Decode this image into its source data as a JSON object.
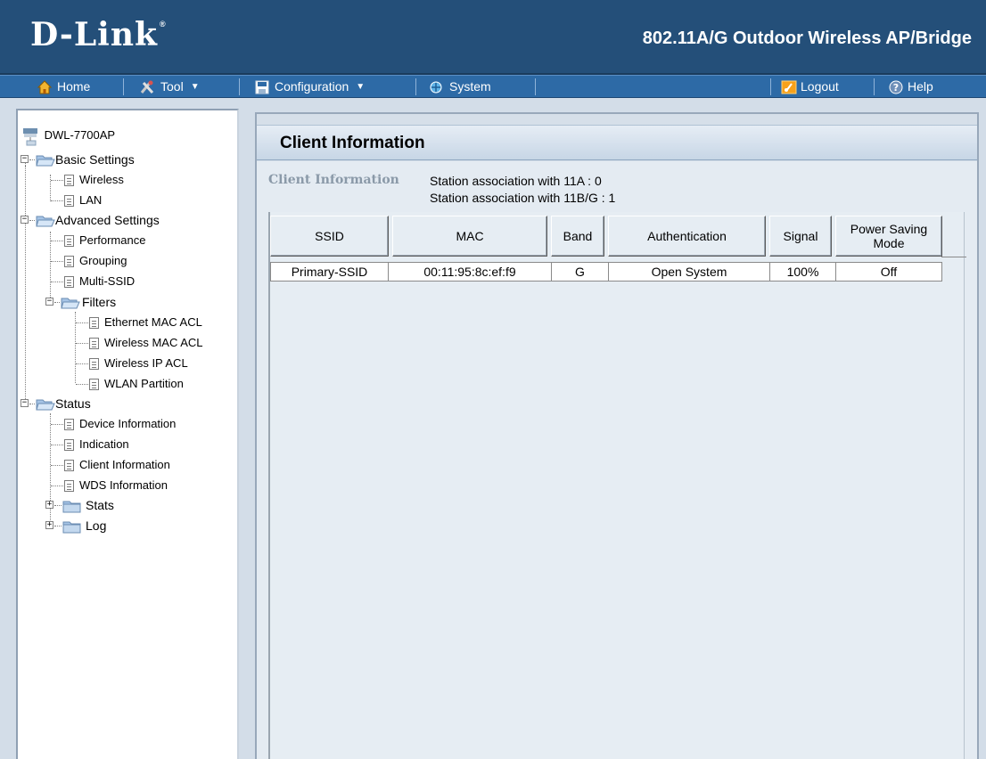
{
  "header": {
    "logo": "D-Link",
    "logo_mark": "®",
    "product": "802.11A/G Outdoor Wireless AP/Bridge"
  },
  "menubar": {
    "home": "Home",
    "tool": "Tool",
    "configuration": "Configuration",
    "system": "System",
    "logout": "Logout",
    "help": "Help"
  },
  "tree": {
    "root": "DWL-7700AP",
    "basic": "Basic Settings",
    "wireless": "Wireless",
    "lan": "LAN",
    "advanced": "Advanced Settings",
    "performance": "Performance",
    "grouping": "Grouping",
    "multi_ssid": "Multi-SSID",
    "filters": "Filters",
    "eth_mac_acl": "Ethernet MAC ACL",
    "wl_mac_acl": "Wireless MAC ACL",
    "wl_ip_acl": "Wireless IP ACL",
    "wlan_partition": "WLAN Partition",
    "status": "Status",
    "device_info": "Device Information",
    "indication": "Indication",
    "client_info": "Client Information",
    "wds_info": "WDS Information",
    "stats": "Stats",
    "log": "Log"
  },
  "page": {
    "title": "Client Information",
    "section_label": "Client Information",
    "assoc_11a": "Station association with 11A : 0",
    "assoc_11bg": "Station association with 11B/G : 1"
  },
  "table": {
    "headers": [
      "SSID",
      "MAC",
      "Band",
      "Authentication",
      "Signal",
      "Power Saving Mode"
    ],
    "rows": [
      [
        "Primary-SSID",
        "00:11:95:8c:ef:f9",
        "G",
        "Open System",
        "100%",
        "Off"
      ]
    ]
  },
  "colors": {
    "header_bg": "#244f79",
    "menubar_bg": "#2d6aa6",
    "panel_bg": "#d6dfe9"
  }
}
